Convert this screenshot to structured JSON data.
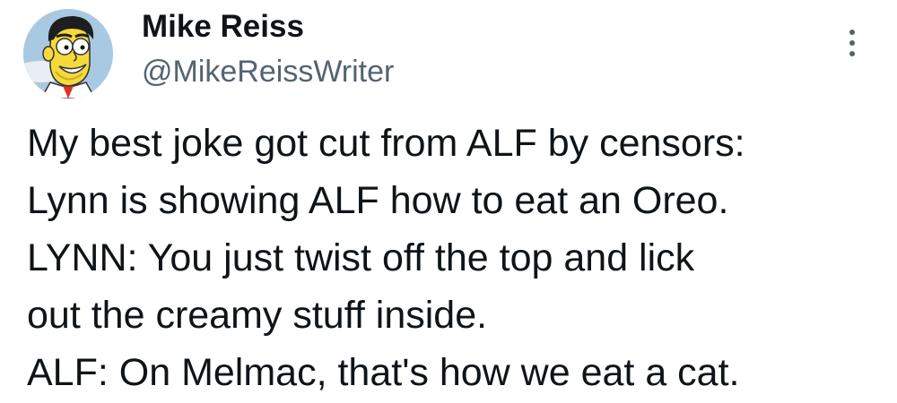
{
  "author": {
    "display_name": "Mike Reiss",
    "handle": "@MikeReissWriter",
    "avatar_icon": "cartoon-avatar"
  },
  "actions": {
    "more_icon": "more-vertical-icon"
  },
  "tweet": {
    "lines": [
      "My best joke got cut from ALF by censors:",
      "Lynn is showing ALF how to eat an Oreo.",
      "LYNN: You just twist off the top and lick",
      "out the creamy stuff inside.",
      "ALF: On Melmac, that's how we eat a cat."
    ]
  },
  "colors": {
    "text": "#0f1419",
    "secondary": "#536471",
    "background": "#ffffff"
  }
}
